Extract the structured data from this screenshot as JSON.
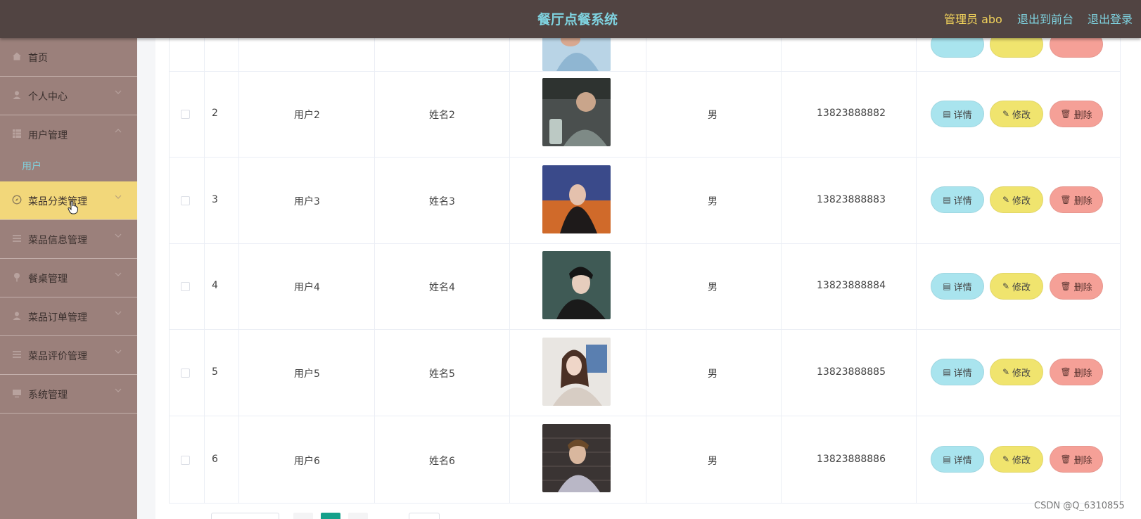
{
  "header": {
    "title": "餐厅点餐系统",
    "admin_label": "管理员 abo",
    "front_link": "退出到前台",
    "logout_link": "退出登录"
  },
  "sidebar": {
    "items": [
      {
        "label": "首页",
        "icon": "home-icon"
      },
      {
        "label": "个人中心",
        "icon": "user-icon"
      },
      {
        "label": "用户管理",
        "icon": "grid-icon"
      },
      {
        "label": "菜品分类管理",
        "icon": "compass-icon"
      },
      {
        "label": "菜品信息管理",
        "icon": "list-icon"
      },
      {
        "label": "餐桌管理",
        "icon": "pin-icon"
      },
      {
        "label": "菜品订单管理",
        "icon": "user-icon"
      },
      {
        "label": "菜品评价管理",
        "icon": "list-icon"
      },
      {
        "label": "系统管理",
        "icon": "monitor-icon"
      }
    ],
    "sub_item": "用户",
    "active_item": "菜品分类管理"
  },
  "table": {
    "rows": [
      {
        "id": "2",
        "account": "用户2",
        "name": "姓名2",
        "gender": "男",
        "phone": "13823888882"
      },
      {
        "id": "3",
        "account": "用户3",
        "name": "姓名3",
        "gender": "男",
        "phone": "13823888883"
      },
      {
        "id": "4",
        "account": "用户4",
        "name": "姓名4",
        "gender": "男",
        "phone": "13823888884"
      },
      {
        "id": "5",
        "account": "用户5",
        "name": "姓名5",
        "gender": "男",
        "phone": "13823888885"
      },
      {
        "id": "6",
        "account": "用户6",
        "name": "姓名6",
        "gender": "男",
        "phone": "13823888886"
      }
    ],
    "actions": {
      "detail": "详情",
      "edit": "修改",
      "delete": "删除"
    }
  },
  "watermark": "CSDN @Q_6310855",
  "colors": {
    "header_bg": "#514442",
    "sidebar_bg": "#9b807b",
    "active_bg": "#f2d77a",
    "title_color": "#7fd3e0",
    "admin_color": "#f2d35b",
    "detail_btn": "#a9e4ee",
    "edit_btn": "#f0e46e",
    "delete_btn": "#f5a097",
    "pager_active": "#15a08a"
  }
}
